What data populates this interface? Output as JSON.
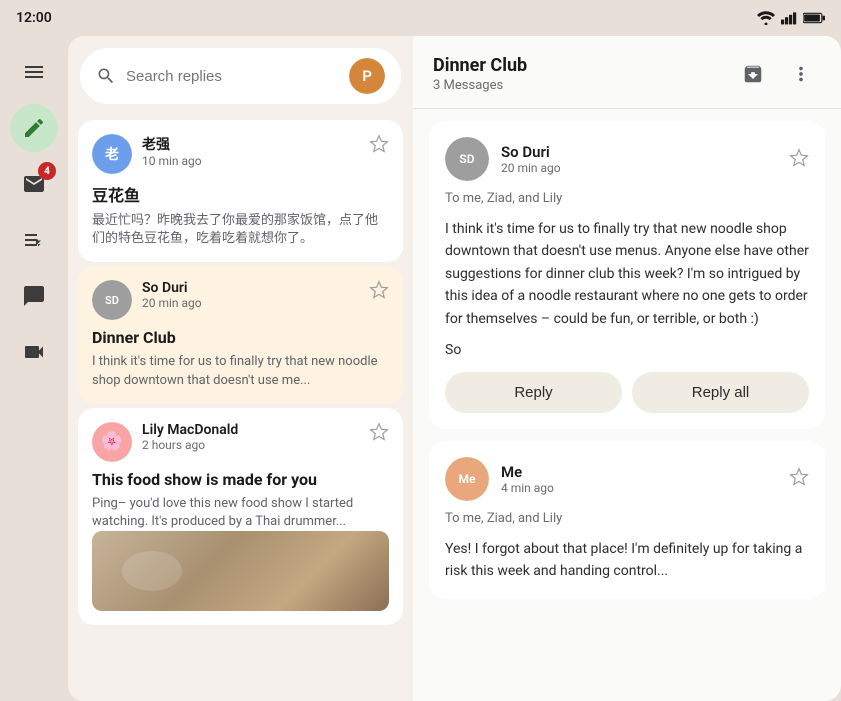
{
  "statusBar": {
    "time": "12:00"
  },
  "sidebar": {
    "items": [
      {
        "id": "menu",
        "icon": "menu-icon",
        "active": false
      },
      {
        "id": "compose",
        "icon": "compose-icon",
        "active": true
      },
      {
        "id": "mail-badge",
        "icon": "mail-icon",
        "active": false,
        "badge": "4"
      },
      {
        "id": "notes",
        "icon": "notes-icon",
        "active": false
      },
      {
        "id": "chat",
        "icon": "chat-icon",
        "active": false
      },
      {
        "id": "video",
        "icon": "video-icon",
        "active": false
      }
    ]
  },
  "leftPanel": {
    "searchPlaceholder": "Search replies",
    "messages": [
      {
        "id": "msg1",
        "sender": "老强",
        "time": "10 min ago",
        "subject": "豆花鱼",
        "preview": "最近忙吗？昨晚我去了你最爱的那家饭馆，点了他们的特色豆花鱼，吃着吃着就想你了。",
        "selected": false,
        "avatarColor": "#6d9eeb",
        "avatarText": "老"
      },
      {
        "id": "msg2",
        "sender": "So Duri",
        "time": "20 min ago",
        "subject": "Dinner Club",
        "preview": "I think it's time for us to finally try that new noodle shop downtown that doesn't use me...",
        "selected": true,
        "avatarColor": "#a0a0a0",
        "avatarText": "SD"
      },
      {
        "id": "msg3",
        "sender": "Lily MacDonald",
        "time": "2 hours ago",
        "subject": "This food show is made for you",
        "preview": "Ping– you'd love this new food show I started watching. It's produced by a Thai drummer...",
        "selected": false,
        "avatarColor": "#f8a4a4",
        "avatarText": "🌸",
        "hasImage": true
      }
    ]
  },
  "rightPanel": {
    "threadTitle": "Dinner Club",
    "threadSubtitle": "3 Messages",
    "messages": [
      {
        "id": "rmsg1",
        "sender": "So Duri",
        "time": "20 min ago",
        "recipient": "To me, Ziad, and Lily",
        "body": "I think it's time for us to finally try that new noodle shop downtown that doesn't use menus. Anyone else have other suggestions for dinner club this week? I'm so intrigued by this idea of a noodle restaurant where no one gets to order for themselves – could be fun, or terrible, or both :)",
        "signature": "So",
        "avatarColor": "#9e9e9e",
        "avatarText": "SD",
        "showReply": true,
        "replyLabel": "Reply",
        "replyAllLabel": "Reply all"
      },
      {
        "id": "rmsg2",
        "sender": "Me",
        "time": "4 min ago",
        "recipient": "To me, Ziad, and Lily",
        "body": "Yes! I forgot about that place! I'm definitely up for taking a risk this week and handing control...",
        "avatarColor": "#e8a87c",
        "avatarText": "Me",
        "showReply": false
      }
    ]
  }
}
